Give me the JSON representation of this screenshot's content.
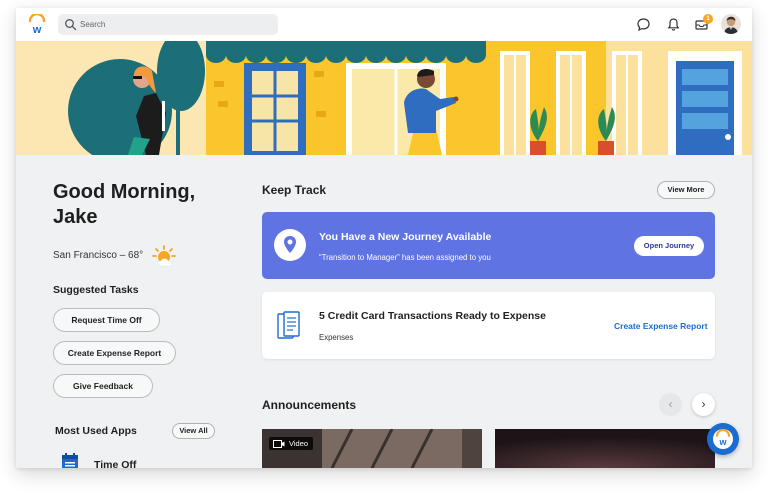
{
  "topbar": {
    "search_placeholder": "Search",
    "notification_count": "1"
  },
  "greeting": {
    "line1": "Good Morning,",
    "line2": "Jake",
    "weather": "San Francisco – 68°"
  },
  "suggested_tasks": {
    "title": "Suggested Tasks",
    "items": [
      "Request Time Off",
      "Create Expense Report",
      "Give Feedback"
    ]
  },
  "most_used_apps": {
    "title": "Most Used Apps",
    "view_all_label": "View All",
    "first_app": "Time Off"
  },
  "keep_track": {
    "title": "Keep Track",
    "view_more_label": "View More",
    "journey_card": {
      "title": "You Have a New Journey Available",
      "subtitle": "“Transition to Manager” has been assigned to you",
      "button_label": "Open Journey"
    },
    "expense_card": {
      "title": "5 Credit Card Transactions Ready to Expense",
      "subtitle": "Expenses",
      "link_label": "Create Expense Report"
    }
  },
  "announcements": {
    "title": "Announcements",
    "prev_label": "‹",
    "next_label": "›",
    "video_label": "Video"
  },
  "colors": {
    "accent_blue": "#5f73e3",
    "link_blue": "#1b6cd1",
    "brand_orange": "#f5a623"
  }
}
